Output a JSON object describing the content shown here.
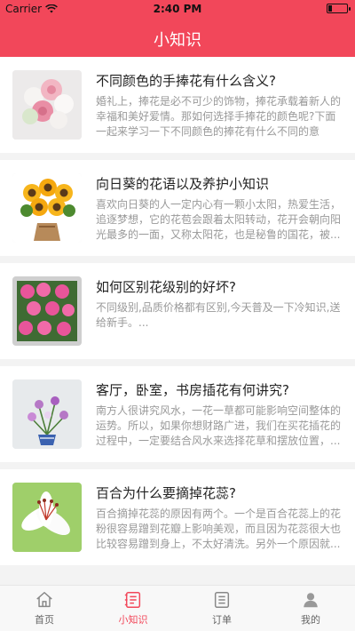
{
  "status_bar": {
    "carrier": "Carrier",
    "time": "2:40 PM"
  },
  "header": {
    "title": "小知识"
  },
  "articles": [
    {
      "title": "不同颜色的手捧花有什么含义?",
      "excerpt": "婚礼上，捧花是必不可少的饰物，捧花承载着新人的幸福和美好爱情。那如何选择手捧花的颜色呢?下面一起来学习一下不同颜色的捧花有什么不同的意义。..."
    },
    {
      "title": "向日葵的花语以及养护小知识",
      "excerpt": "喜欢向日葵的人一定内心有一颗小太阳，热爱生活，追逐梦想，它的花苞会跟着太阳转动，花开会朝向阳光最多的一面，又称太阳花，也是秘鲁的国花，被..."
    },
    {
      "title": "如何区别花级别的好坏?",
      "excerpt": "不同级别,品质价格都有区别,今天普及一下冷知识,送给新手。..."
    },
    {
      "title": "客厅，卧室，书房插花有何讲究?",
      "excerpt": "南方人很讲究风水，一花一草都可能影响空间整体的运势。所以，如果你想财路广进，我们在买花插花的过程中，一定要结合风水来选择花草和摆放位置，..."
    },
    {
      "title": "百合为什么要摘掉花蕊?",
      "excerpt": "百合摘掉花蕊的原因有两个。一个是百合花蕊上的花粉很容易蹭到花瓣上影响美观，而且因为花蕊很大也比较容易蹭到身上，不太好清洗。另外一个原因就..."
    }
  ],
  "tabbar": {
    "items": [
      {
        "label": "首页",
        "icon": "home-icon"
      },
      {
        "label": "小知识",
        "icon": "knowledge-icon"
      },
      {
        "label": "订单",
        "icon": "order-icon"
      },
      {
        "label": "我的",
        "icon": "profile-icon"
      }
    ],
    "active_index": 1
  },
  "colors": {
    "accent": "#f2475a",
    "excerpt_text": "#999999",
    "title_text": "#222222"
  }
}
